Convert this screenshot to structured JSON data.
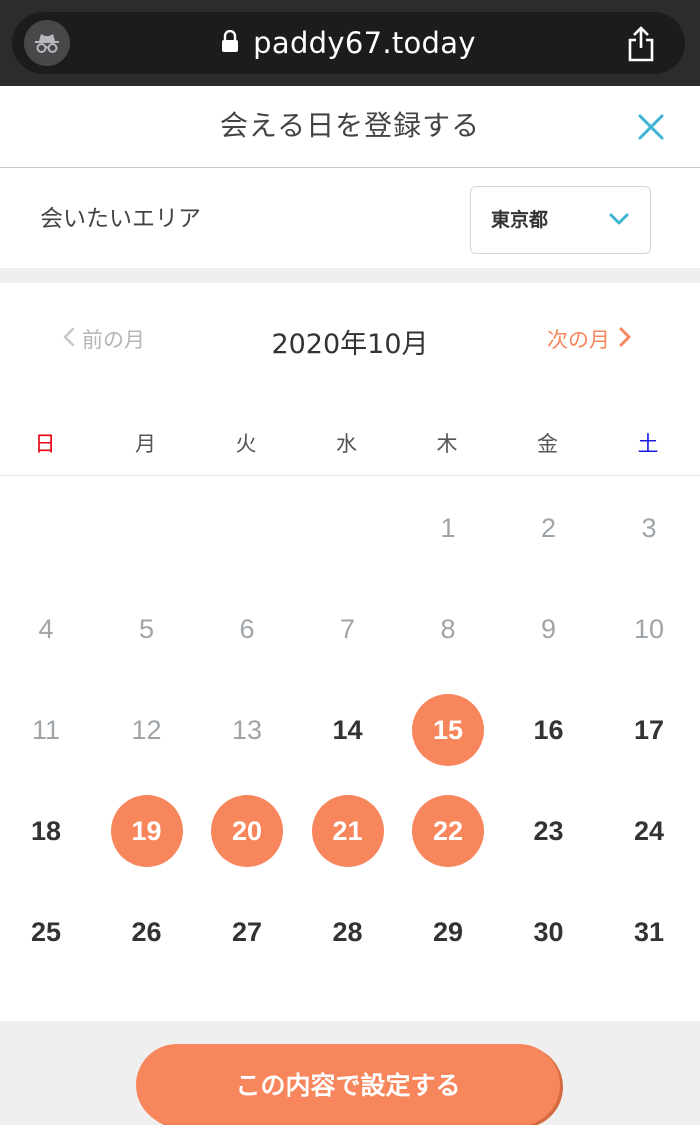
{
  "browser": {
    "url": "paddy67.today",
    "icons": {
      "incognito": "incognito-icon",
      "lock": "lock-icon",
      "share": "share-icon"
    }
  },
  "modal": {
    "title": "会える日を登録する",
    "close_icon": "close-icon"
  },
  "area": {
    "label": "会いたいエリア",
    "selected": "東京都"
  },
  "calendar": {
    "prev_label": "前の月",
    "next_label": "次の月",
    "month_title": "2020年10月",
    "weekdays": [
      "日",
      "月",
      "火",
      "水",
      "木",
      "金",
      "土"
    ],
    "weekday_colors": [
      "#e60012",
      "#555555",
      "#555555",
      "#555555",
      "#555555",
      "#555555",
      "#1a1ae6"
    ],
    "days": [
      {
        "label": "1",
        "col": 4,
        "row": 0,
        "state": "past"
      },
      {
        "label": "2",
        "col": 5,
        "row": 0,
        "state": "past"
      },
      {
        "label": "3",
        "col": 6,
        "row": 0,
        "state": "past"
      },
      {
        "label": "4",
        "col": 0,
        "row": 1,
        "state": "past"
      },
      {
        "label": "5",
        "col": 1,
        "row": 1,
        "state": "past"
      },
      {
        "label": "6",
        "col": 2,
        "row": 1,
        "state": "past"
      },
      {
        "label": "7",
        "col": 3,
        "row": 1,
        "state": "past"
      },
      {
        "label": "8",
        "col": 4,
        "row": 1,
        "state": "past"
      },
      {
        "label": "9",
        "col": 5,
        "row": 1,
        "state": "past"
      },
      {
        "label": "10",
        "col": 6,
        "row": 1,
        "state": "past"
      },
      {
        "label": "11",
        "col": 0,
        "row": 2,
        "state": "past"
      },
      {
        "label": "12",
        "col": 1,
        "row": 2,
        "state": "past"
      },
      {
        "label": "13",
        "col": 2,
        "row": 2,
        "state": "past"
      },
      {
        "label": "14",
        "col": 3,
        "row": 2,
        "state": "future"
      },
      {
        "label": "15",
        "col": 4,
        "row": 2,
        "state": "selected"
      },
      {
        "label": "16",
        "col": 5,
        "row": 2,
        "state": "future"
      },
      {
        "label": "17",
        "col": 6,
        "row": 2,
        "state": "future"
      },
      {
        "label": "18",
        "col": 0,
        "row": 3,
        "state": "future"
      },
      {
        "label": "19",
        "col": 1,
        "row": 3,
        "state": "selected"
      },
      {
        "label": "20",
        "col": 2,
        "row": 3,
        "state": "selected"
      },
      {
        "label": "21",
        "col": 3,
        "row": 3,
        "state": "selected"
      },
      {
        "label": "22",
        "col": 4,
        "row": 3,
        "state": "selected"
      },
      {
        "label": "23",
        "col": 5,
        "row": 3,
        "state": "future"
      },
      {
        "label": "24",
        "col": 6,
        "row": 3,
        "state": "future"
      },
      {
        "label": "25",
        "col": 0,
        "row": 4,
        "state": "future"
      },
      {
        "label": "26",
        "col": 1,
        "row": 4,
        "state": "future"
      },
      {
        "label": "27",
        "col": 2,
        "row": 4,
        "state": "future"
      },
      {
        "label": "28",
        "col": 3,
        "row": 4,
        "state": "future"
      },
      {
        "label": "29",
        "col": 4,
        "row": 4,
        "state": "future"
      },
      {
        "label": "30",
        "col": 5,
        "row": 4,
        "state": "future"
      },
      {
        "label": "31",
        "col": 6,
        "row": 4,
        "state": "future"
      }
    ]
  },
  "footer": {
    "submit_label": "この内容で設定する"
  },
  "colors": {
    "accent": "#f7865c",
    "close": "#3cb4d2",
    "sunday": "#e60012",
    "saturday": "#1a1ae6"
  }
}
